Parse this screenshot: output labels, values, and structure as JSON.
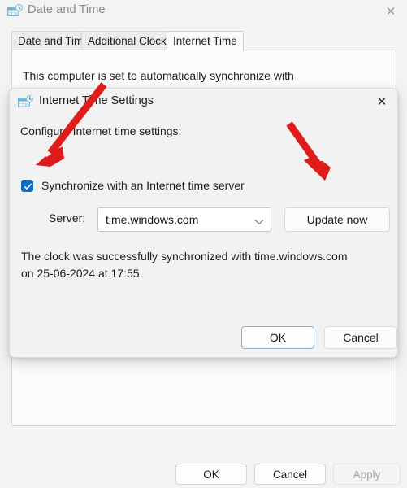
{
  "window": {
    "title": "Date and Time",
    "icon": "date-time-icon",
    "close_label": "✕",
    "tabs": [
      {
        "label": "Date and Time",
        "active": false
      },
      {
        "label": "Additional Clocks",
        "active": false
      },
      {
        "label": "Internet Time",
        "active": true
      }
    ],
    "panel_note": "This computer is set to automatically synchronize with",
    "footer_buttons": [
      {
        "label": "OK",
        "disabled": false
      },
      {
        "label": "Cancel",
        "disabled": false
      },
      {
        "label": "Apply",
        "disabled": true
      }
    ]
  },
  "dialog": {
    "title": "Internet Time Settings",
    "icon": "date-time-icon",
    "close_label": "✕",
    "heading": "Configure Internet time settings:",
    "checkbox": {
      "label": "Synchronize with an Internet time server",
      "checked": true
    },
    "server": {
      "label": "Server:",
      "value": "time.windows.com",
      "chevron": "chevron-down-icon"
    },
    "update_button": "Update now",
    "status": "The clock was successfully synchronized with time.windows.com on 25-06-2024 at 17:55.",
    "ok_label": "OK",
    "cancel_label": "Cancel"
  },
  "annotations": {
    "arrow_color": "#e01b1b",
    "arrows": [
      {
        "name": "arrow-to-checkbox",
        "target": "synchronize-checkbox"
      },
      {
        "name": "arrow-to-update-now",
        "target": "update-now-button"
      }
    ]
  },
  "colors": {
    "accent": "#0e6cc4",
    "window_bg": "#f3f3f3",
    "panel_bg": "#fbfbfb",
    "dialog_bg": "#f2f2f2",
    "focus_border": "#8ab0cc"
  }
}
